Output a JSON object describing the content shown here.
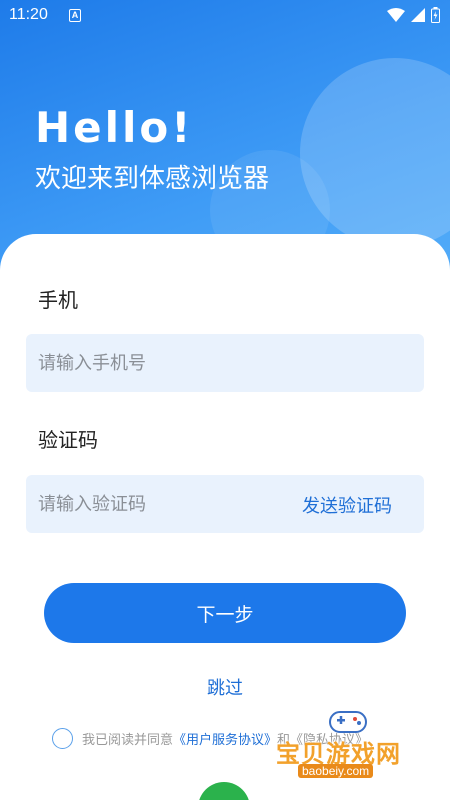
{
  "status": {
    "time": "11:20",
    "notif_letter": "A"
  },
  "hero": {
    "greeting": "Hello!",
    "welcome": "欢迎来到体感浏览器"
  },
  "form": {
    "phone_label": "手机",
    "phone_placeholder": "请输入手机号",
    "code_label": "验证码",
    "code_placeholder": "请输入验证码",
    "send_code": "发送验证码",
    "next_button": "下一步",
    "skip": "跳过"
  },
  "agreement": {
    "prefix": "我已阅读并同意",
    "link": "《用户服务协议》",
    "suffix": "和《隐私协议》"
  },
  "watermark": {
    "name": "宝贝游戏网",
    "url": "baobeiy.com"
  },
  "colors": {
    "primary": "#1d78ea",
    "link": "#1f6fd6",
    "input_bg": "#e9f2fd"
  }
}
